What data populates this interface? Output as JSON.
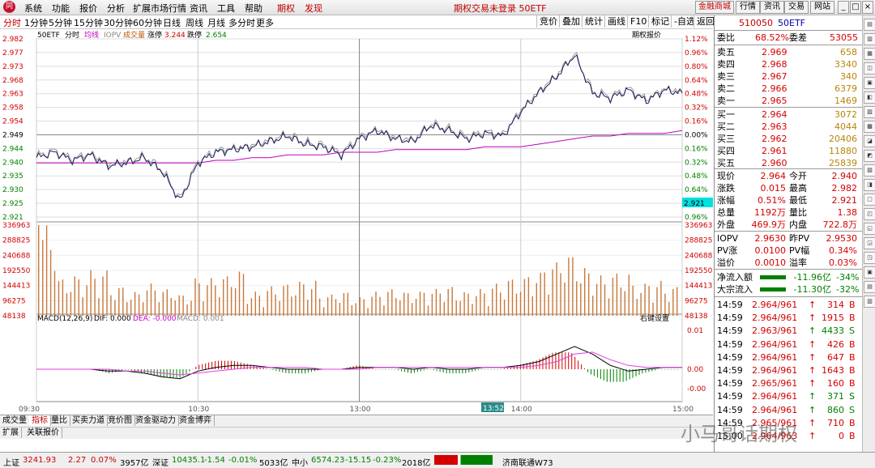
{
  "menu": [
    "系统",
    "功能",
    "报价",
    "分析",
    "扩展市场行情",
    "资讯",
    "工具",
    "帮助"
  ],
  "menu_hl": [
    "期权",
    "发现"
  ],
  "window_title": "期权交易未登录 50ETF",
  "top_right": {
    "tab1": "金融商城",
    "tab2": "行情",
    "tab3": "资讯",
    "tab4": "交易",
    "tab5": "网站"
  },
  "periods": [
    "分时",
    "1分钟",
    "5分钟",
    "15分钟",
    "30分钟",
    "60分钟",
    "日线",
    "周线",
    "月线",
    "多分时",
    "更多"
  ],
  "toolbar": {
    "b1": "竞价",
    "b2": "叠加",
    "b3": "统计",
    "b4": "画线",
    "b5": "F10",
    "b6": "标记",
    "b7": "-自选",
    "b8": "返回"
  },
  "chart_header": {
    "name": "50ETF",
    "fs": "分时",
    "jx": "均线",
    "iopv": "IOPV",
    "cjl": "成交量",
    "zt_label": "涨停",
    "zt": "3.244",
    "dt_label": "跌停",
    "dt": "2.654",
    "qqbj": "期权报价"
  },
  "macd_header": {
    "label": "MACD(12,26,9)",
    "dif": "DIF: 0.000",
    "dea": "DEA: -0.000",
    "macd": "MACD: 0.001",
    "setting": "右键设置"
  },
  "price_ticks": [
    "2.982",
    "2.977",
    "2.973",
    "2.968",
    "2.963",
    "2.958",
    "2.954",
    "2.949",
    "2.944",
    "2.940",
    "2.935",
    "2.930",
    "2.925",
    "2.921"
  ],
  "pct_ticks": [
    "1.12%",
    "0.96%",
    "0.80%",
    "0.64%",
    "0.48%",
    "0.32%",
    "0.16%",
    "0.00%",
    "0.16%",
    "0.32%",
    "0.48%",
    "0.64%",
    "0.80%",
    "0.96%"
  ],
  "current_price_tag": "2.921",
  "vol_ticks": [
    "336963",
    "288825",
    "240688",
    "192550",
    "144413",
    "96275",
    "48138"
  ],
  "macd_ticks": [
    "0.01",
    "0.00",
    "-0.00"
  ],
  "time_ticks": [
    "09:30",
    "10:30",
    "13:00",
    "14:00",
    "15:00"
  ],
  "cursor_time": "13:52",
  "chart_data": {
    "type": "line",
    "x": [
      "09:30",
      "10:30",
      "11:30/13:00",
      "14:00",
      "15:00"
    ],
    "ylim": [
      2.916,
      2.982
    ],
    "prev_close": 2.949,
    "series": [
      {
        "name": "50ETF",
        "ohlc_note": "intraday price"
      }
    ],
    "price": [
      2.938,
      2.94,
      2.937,
      2.939,
      2.935,
      2.936,
      2.938,
      2.933,
      2.922,
      2.936,
      2.94,
      2.941,
      2.942,
      2.944,
      2.946,
      2.943,
      2.942,
      2.939,
      2.945,
      2.948,
      2.945,
      2.944,
      2.95,
      2.948,
      2.945,
      2.947,
      2.946,
      2.955,
      2.962,
      2.968,
      2.976,
      2.962,
      2.96,
      2.963,
      2.959,
      2.963,
      2.962
    ],
    "avg": [
      2.936,
      2.936,
      2.936,
      2.936,
      2.936,
      2.936,
      2.936,
      2.936,
      2.936,
      2.936,
      2.937,
      2.937,
      2.938,
      2.938,
      2.939,
      2.939,
      2.939,
      2.94,
      2.94,
      2.94,
      2.941,
      2.941,
      2.941,
      2.941,
      2.941,
      2.942,
      2.942,
      2.942,
      2.943,
      2.944,
      2.945,
      2.946,
      2.946,
      2.947,
      2.947,
      2.947,
      2.948
    ],
    "volume": [
      336963,
      140000,
      150000,
      170000,
      110000,
      90000,
      120000,
      100000,
      80000,
      140000,
      150000,
      170000,
      90000,
      110000,
      120000,
      130000,
      80000,
      90000,
      70000,
      90000,
      100000,
      90000,
      100000,
      110000,
      90000,
      100000,
      120000,
      140000,
      160000,
      200000,
      230000,
      180000,
      150000,
      160000,
      120000,
      130000,
      110000
    ],
    "macd": {
      "dif": [
        0.0,
        0.0,
        0.0,
        0.0,
        -0.001,
        -0.001,
        -0.002,
        -0.004,
        -0.005,
        -0.001,
        0.001,
        0.002,
        0.002,
        0.001,
        0.0,
        0.0,
        0.0,
        0.0,
        0.001,
        0.001,
        0.001,
        0.0,
        0.001,
        0.0,
        0.0,
        0.001,
        0.001,
        0.002,
        0.004,
        0.008,
        0.012,
        0.008,
        0.002,
        -0.001,
        0.0,
        0.001,
        0.001
      ],
      "dea": [
        0.0,
        0.0,
        0.0,
        0.0,
        0.0,
        -0.001,
        -0.001,
        -0.002,
        -0.003,
        -0.002,
        -0.001,
        0.0,
        0.001,
        0.001,
        0.001,
        0.001,
        0.0,
        0.0,
        0.0,
        0.001,
        0.001,
        0.001,
        0.001,
        0.001,
        0.001,
        0.001,
        0.001,
        0.001,
        0.002,
        0.004,
        0.008,
        0.009,
        0.005,
        0.002,
        0.001,
        0.001,
        0.001
      ]
    }
  },
  "quote": {
    "code": "510050",
    "name": "50ETF",
    "wb_label": "委比",
    "wb": "68.52%",
    "wc_label": "委差",
    "wc": "53055",
    "asks": [
      {
        "l": "卖五",
        "p": "2.969",
        "v": "658"
      },
      {
        "l": "卖四",
        "p": "2.968",
        "v": "3340"
      },
      {
        "l": "卖三",
        "p": "2.967",
        "v": "340"
      },
      {
        "l": "卖二",
        "p": "2.966",
        "v": "6379"
      },
      {
        "l": "卖一",
        "p": "2.965",
        "v": "1469"
      }
    ],
    "bids": [
      {
        "l": "买一",
        "p": "2.964",
        "v": "3072"
      },
      {
        "l": "买二",
        "p": "2.963",
        "v": "4044"
      },
      {
        "l": "买三",
        "p": "2.962",
        "v": "20406"
      },
      {
        "l": "买四",
        "p": "2.961",
        "v": "11880"
      },
      {
        "l": "买五",
        "p": "2.960",
        "v": "25839"
      }
    ],
    "stats": [
      {
        "a": "现价",
        "av": "2.964",
        "b": "今开",
        "bv": "2.940"
      },
      {
        "a": "涨跌",
        "av": "0.015",
        "b": "最高",
        "bv": "2.982"
      },
      {
        "a": "涨幅",
        "av": "0.51%",
        "b": "最低",
        "bv": "2.921"
      },
      {
        "a": "总量",
        "av": "1192万",
        "b": "量比",
        "bv": "1.38"
      },
      {
        "a": "外盘",
        "av": "469.9万",
        "b": "内盘",
        "bv": "722.8万"
      }
    ],
    "iopv": [
      {
        "a": "IOPV",
        "av": "2.9630",
        "b": "昨PV",
        "bv": "2.9530"
      },
      {
        "a": "PV涨",
        "av": "0.0100",
        "b": "PV幅",
        "bv": "0.34%"
      },
      {
        "a": "溢价",
        "av": "0.0010",
        "b": "溢率",
        "bv": "0.03%"
      }
    ],
    "flow": [
      {
        "l": "净流入额",
        "v": "-11.96亿",
        "p": "-34%"
      },
      {
        "l": "大宗流入",
        "v": "-11.30亿",
        "p": "-32%"
      }
    ],
    "ticks": [
      {
        "t": "14:59",
        "p": "2.964/961",
        "v": "314",
        "s": "B"
      },
      {
        "t": "14:59",
        "p": "2.964/961",
        "v": "1915",
        "s": "B"
      },
      {
        "t": "14:59",
        "p": "2.963/961",
        "v": "4433",
        "s": "S"
      },
      {
        "t": "14:59",
        "p": "2.964/961",
        "v": "426",
        "s": "B"
      },
      {
        "t": "14:59",
        "p": "2.964/961",
        "v": "647",
        "s": "B"
      },
      {
        "t": "14:59",
        "p": "2.964/961",
        "v": "1643",
        "s": "B"
      },
      {
        "t": "14:59",
        "p": "2.965/961",
        "v": "160",
        "s": "B"
      },
      {
        "t": "14:59",
        "p": "2.964/961",
        "v": "371",
        "s": "S"
      },
      {
        "t": "14:59",
        "p": "2.964/961",
        "v": "860",
        "s": "S"
      },
      {
        "t": "14:59",
        "p": "2.965/961",
        "v": "710",
        "s": "B"
      },
      {
        "t": "15:00",
        "p": "2.964/963",
        "v": "0",
        "s": "B"
      }
    ]
  },
  "tabs1": [
    "成交量",
    "指标",
    "量比",
    "买卖力道",
    "竞价图",
    "资金驱动力",
    "资金博弈"
  ],
  "tabs2": [
    "扩展",
    "关联报价"
  ],
  "status": {
    "sh_label": "上证",
    "sh": "3241.93",
    "sh_chg": "2.27",
    "sh_pct": "0.07%",
    "sh_amt": "3957亿",
    "sz_label": "深证",
    "sz": "10435.1",
    "sz_chg": "-1.54",
    "sz_pct": "-0.01%",
    "sz_amt": "5033亿",
    "zx_label": "中小",
    "zx": "6574.23",
    "zx_chg": "-15.15",
    "zx_pct": "-0.23%",
    "zx_amt": "2018亿",
    "link": "济南联通W73"
  },
  "watermark": "小马哥话期权"
}
